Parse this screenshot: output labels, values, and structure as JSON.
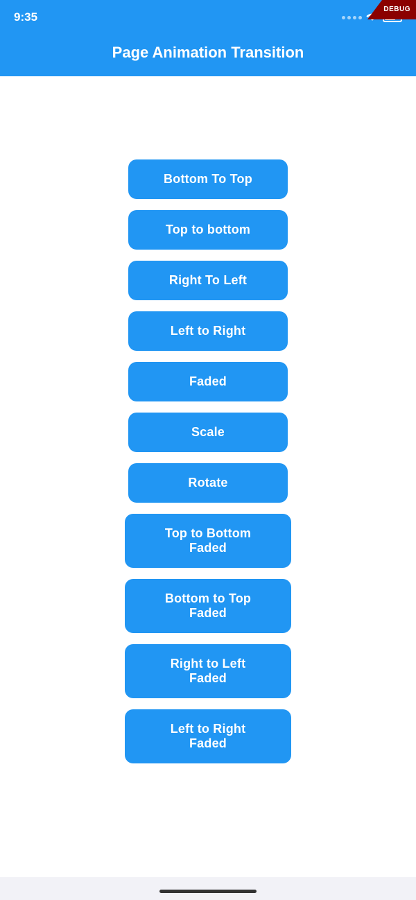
{
  "statusBar": {
    "time": "9:35",
    "debugLabel": "DEBUG"
  },
  "header": {
    "title": "Page Animation Transition"
  },
  "buttons": [
    {
      "id": "bottom-to-top",
      "label": "Bottom To Top",
      "wide": false
    },
    {
      "id": "top-to-bottom",
      "label": "Top to bottom",
      "wide": false
    },
    {
      "id": "right-to-left",
      "label": "Right To Left",
      "wide": false
    },
    {
      "id": "left-to-right",
      "label": "Left to Right",
      "wide": false
    },
    {
      "id": "faded",
      "label": "Faded",
      "wide": false
    },
    {
      "id": "scale",
      "label": "Scale",
      "wide": false
    },
    {
      "id": "rotate",
      "label": "Rotate",
      "wide": false
    },
    {
      "id": "top-to-bottom-faded",
      "label": "Top to Bottom Faded",
      "wide": true
    },
    {
      "id": "bottom-to-top-faded",
      "label": "Bottom to Top Faded",
      "wide": true
    },
    {
      "id": "right-to-left-faded",
      "label": "Right to Left Faded",
      "wide": true
    },
    {
      "id": "left-to-right-faded",
      "label": "Left to Right Faded",
      "wide": true
    }
  ],
  "colors": {
    "accent": "#2196f3",
    "appBarBg": "#2196f3",
    "buttonBg": "#2196f3",
    "buttonText": "#ffffff",
    "debugBg": "#8b0000"
  }
}
